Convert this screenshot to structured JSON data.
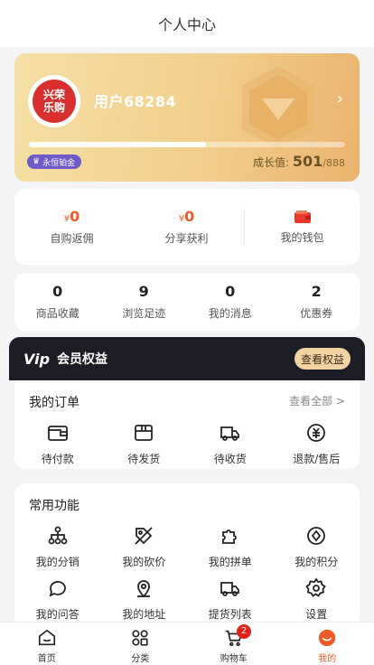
{
  "header": {
    "title": "个人中心"
  },
  "member": {
    "logo_text": [
      "兴荣",
      "乐购"
    ],
    "username": "用户68284",
    "level": "永恒铂金",
    "growth_label": "成长值:",
    "growth_value": "501",
    "growth_max": "/888",
    "progress": 0.56
  },
  "earnings": {
    "currency": "¥",
    "self_amount": "0",
    "self_label": "自购返佣",
    "share_amount": "0",
    "share_label": "分享获利",
    "wallet_label": "我的钱包"
  },
  "stats": [
    {
      "num": "0",
      "label": "商品收藏"
    },
    {
      "num": "9",
      "label": "浏览足迹"
    },
    {
      "num": "0",
      "label": "我的消息"
    },
    {
      "num": "2",
      "label": "优惠券"
    }
  ],
  "vip": {
    "logo": "Vip",
    "label": "会员权益",
    "button": "查看权益"
  },
  "orders": {
    "title": "我的订单",
    "more": "查看全部 >",
    "items": [
      {
        "label": "待付款",
        "icon": "wallet-icon"
      },
      {
        "label": "待发货",
        "icon": "box-icon"
      },
      {
        "label": "待收货",
        "icon": "truck-icon"
      },
      {
        "label": "退款/售后",
        "icon": "refund-icon"
      }
    ]
  },
  "functions": {
    "title": "常用功能",
    "items": [
      {
        "label": "我的分销",
        "icon": "distribution-icon"
      },
      {
        "label": "我的砍价",
        "icon": "bargain-icon"
      },
      {
        "label": "我的拼单",
        "icon": "puzzle-icon"
      },
      {
        "label": "我的积分",
        "icon": "points-icon"
      },
      {
        "label": "我的问答",
        "icon": "chat-icon"
      },
      {
        "label": "我的地址",
        "icon": "location-icon"
      },
      {
        "label": "提货列表",
        "icon": "pickup-truck-icon"
      },
      {
        "label": "设置",
        "icon": "settings-icon"
      }
    ]
  },
  "tabbar": [
    {
      "label": "首页",
      "icon": "home-icon"
    },
    {
      "label": "分类",
      "icon": "category-icon"
    },
    {
      "label": "购物车",
      "icon": "cart-icon",
      "badge": "2"
    },
    {
      "label": "我的",
      "icon": "profile-icon",
      "active": true
    }
  ],
  "colors": {
    "accent": "#f05a28",
    "gold": "#f1cf8c",
    "vip_bg": "#1d1d25"
  }
}
